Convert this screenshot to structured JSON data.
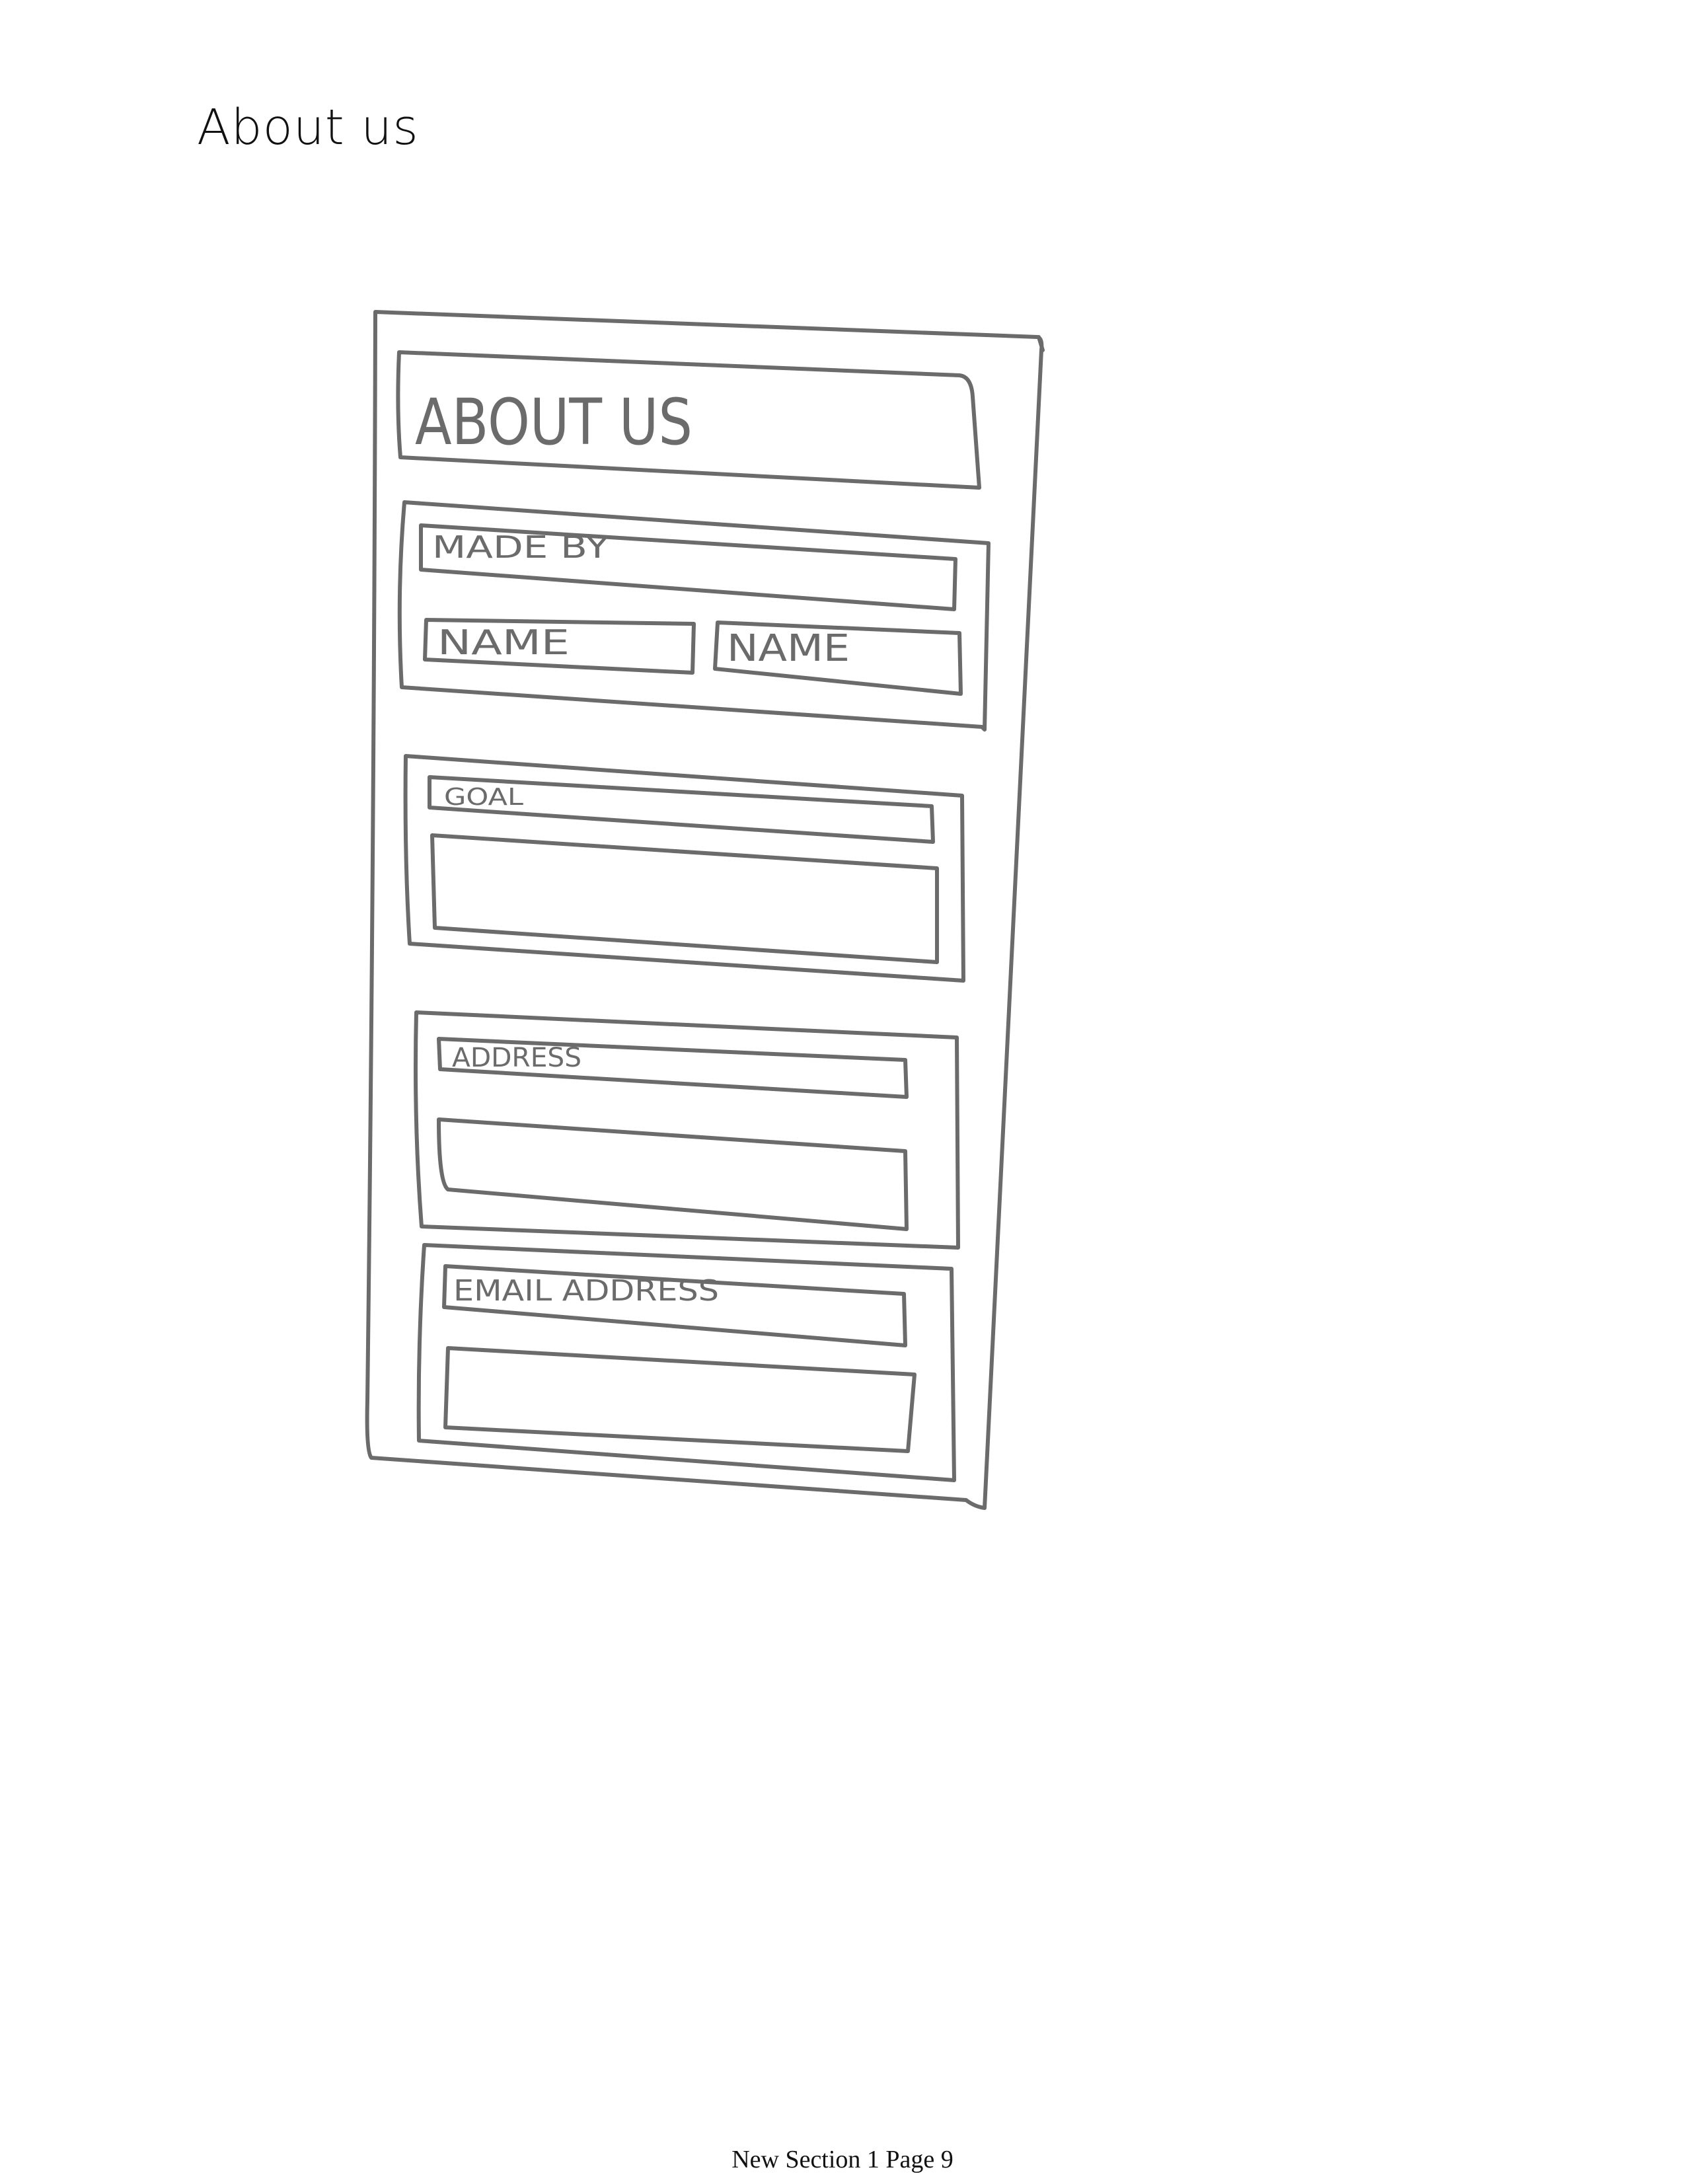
{
  "page": {
    "title": "About us",
    "footer": "New Section 1 Page 9"
  },
  "sketch": {
    "header_label": "ABOUT US",
    "made_by": {
      "label": "MADE BY",
      "names": [
        "NAME",
        "NAME"
      ]
    },
    "goal": {
      "label": "GOAL"
    },
    "address": {
      "label": "ADDRESS"
    },
    "email": {
      "label": "EMAIL ADDRESS"
    }
  },
  "colors": {
    "sketch_stroke": "#6b6b6b",
    "text": "#111111",
    "background": "#ffffff"
  }
}
